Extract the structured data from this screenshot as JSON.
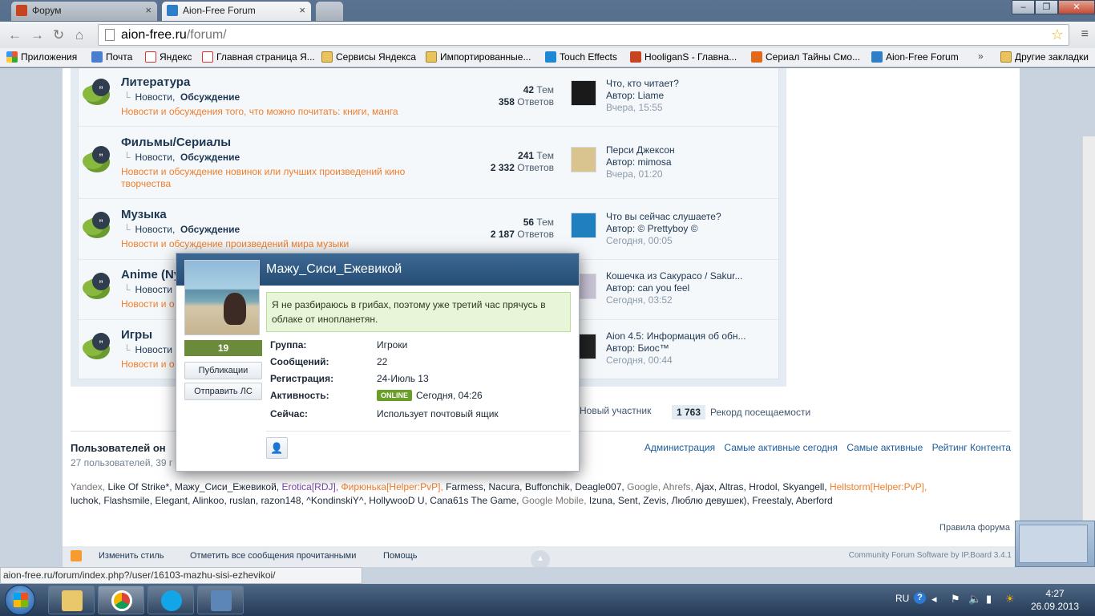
{
  "browser": {
    "tabs": [
      {
        "label": "Форум",
        "favicon_color": "#c8431f"
      },
      {
        "label": "Aion-Free Forum",
        "favicon_color": "#2f7fc8"
      }
    ],
    "url_host": "aion-free.ru",
    "url_path": "/forum/",
    "bookmarks": [
      {
        "label": "Приложения",
        "icon": "apps-icon"
      },
      {
        "label": "Почта",
        "icon": "mail-icon"
      },
      {
        "label": "Яндекс",
        "icon": "yandex-icon"
      },
      {
        "label": "Главная страница Я...",
        "icon": "yandex-icon"
      },
      {
        "label": "Сервисы Яндекса",
        "icon": "folder-icon"
      },
      {
        "label": "Импортированные...",
        "icon": "folder-icon"
      },
      {
        "label": "Touch Effects",
        "icon": "touch-icon"
      },
      {
        "label": "HooliganS - Главна...",
        "icon": "hooligans-icon"
      },
      {
        "label": "Сериал Тайны Смо...",
        "icon": "series-icon"
      },
      {
        "label": "Aion-Free Forum",
        "icon": "aion-icon"
      },
      {
        "label": "Другие закладки",
        "icon": "folder-icon"
      }
    ]
  },
  "forums": [
    {
      "name": "Литература",
      "subforums": [
        "Новости,",
        "Обсуждение"
      ],
      "description": "Новости и обсуждения того, что можно почитать: книги, манга",
      "topics": "42",
      "topics_label": "Тем",
      "replies": "358",
      "replies_label": "Ответов",
      "last_title": "Что, кто читает?",
      "last_author_prefix": "Автор: ",
      "last_author": "Liame",
      "last_time": "Вчера, 15:55",
      "avatar_color": "#1a1a1a"
    },
    {
      "name": "Фильмы/Сериалы",
      "subforums": [
        "Новости,",
        "Обсуждение"
      ],
      "description": "Новости и обсуждение новинок или лучших произведений кино творчества",
      "topics": "241",
      "topics_label": "Тем",
      "replies": "2 332",
      "replies_label": "Ответов",
      "last_title": "Перси Джексон",
      "last_author_prefix": "Автор: ",
      "last_author": "mimosa",
      "last_time": "Вчера, 01:20",
      "avatar_color": "#d9c48f"
    },
    {
      "name": "Музыка",
      "subforums": [
        "Новости,",
        "Обсуждение"
      ],
      "description": "Новости и обсуждение произведений мира музыки",
      "topics": "56",
      "topics_label": "Тем",
      "replies": "2 187",
      "replies_label": "Ответов",
      "last_title": "Что вы сейчас слушаете?",
      "last_author_prefix": "Автор: ",
      "last_author": "© Prettyboy ©",
      "last_time": "Сегодня, 00:05",
      "avatar_color": "#1f7fbf"
    },
    {
      "name": "Anime (Ny",
      "subforums": [
        "Новости"
      ],
      "description": "Новости и о",
      "topics": "",
      "topics_label": "",
      "replies": "",
      "replies_label": "",
      "last_title": "Кошечка из Сакурасо / Sakur...",
      "last_author_prefix": "Автор: ",
      "last_author": "can you feel",
      "last_time": "Сегодня, 03:52",
      "avatar_color": "#c9c3d6"
    },
    {
      "name": "Игры",
      "subforums": [
        "Новости"
      ],
      "description": "Новости и о",
      "topics": "",
      "topics_label": "",
      "replies": "",
      "replies_label": "",
      "last_title": "Aion 4.5: Информация об обн...",
      "last_author_prefix": "Автор: ",
      "last_author": "Биос™",
      "last_time": "Сегодня, 00:44",
      "avatar_color": "#222222"
    }
  ],
  "board_stats": {
    "new_member_label": "Новый участник",
    "record_value": "1 763",
    "record_label": "Рекорд посещаемости"
  },
  "online": {
    "title": "Пользователей он",
    "count": "27 пользователей, 39 г",
    "links": [
      "Администрация",
      "Самые активные сегодня",
      "Самые активные",
      "Рейтинг Контента"
    ],
    "users_line1": [
      {
        "name": "Yandex,",
        "style": "grey"
      },
      {
        "name": "Like Of Strike*,",
        "style": "normal"
      },
      {
        "name": "Мажу_Сиси_Ежевикой,",
        "style": "normal"
      },
      {
        "name": "Erotica[RDJ],",
        "style": "purple"
      },
      {
        "name": "Фирюнька[Helper:PvP],",
        "style": "orange"
      },
      {
        "name": "Farmess,",
        "style": "normal"
      },
      {
        "name": "Nacura,",
        "style": "normal"
      },
      {
        "name": "Buffonchik,",
        "style": "normal"
      },
      {
        "name": "Deagle007,",
        "style": "normal"
      },
      {
        "name": "Google,",
        "style": "grey"
      },
      {
        "name": "Ahrefs,",
        "style": "grey"
      },
      {
        "name": "Ajax,",
        "style": "normal"
      },
      {
        "name": "Altras,",
        "style": "normal"
      },
      {
        "name": "Hrodol,",
        "style": "normal"
      },
      {
        "name": "Skyangell,",
        "style": "normal"
      },
      {
        "name": "Hellstorm[Helper:PvP],",
        "style": "orange"
      }
    ],
    "users_line2": [
      {
        "name": "luchok,",
        "style": "normal"
      },
      {
        "name": "Flashsmile,",
        "style": "normal"
      },
      {
        "name": "Elegant,",
        "style": "normal"
      },
      {
        "name": "Alinkoo,",
        "style": "normal"
      },
      {
        "name": "ruslan,",
        "style": "normal"
      },
      {
        "name": "razon148,",
        "style": "normal"
      },
      {
        "name": "^KondinskiY^,",
        "style": "normal"
      },
      {
        "name": "HollywooD U,",
        "style": "normal"
      },
      {
        "name": "Cana61s The Game,",
        "style": "normal"
      },
      {
        "name": "Google Mobile,",
        "style": "grey"
      },
      {
        "name": "Izuna,",
        "style": "normal"
      },
      {
        "name": "Sent,",
        "style": "normal"
      },
      {
        "name": "Zevis,",
        "style": "normal"
      },
      {
        "name": "Люблю девушек),",
        "style": "normal"
      },
      {
        "name": "Freestaly,",
        "style": "normal"
      },
      {
        "name": "Aberford",
        "style": "normal"
      }
    ],
    "rules_link": "Правила форума"
  },
  "footer": {
    "change_style": "Изменить стиль",
    "mark_read": "Отметить все сообщения прочитанными",
    "help": "Помощь",
    "copyright": "Community Forum Software by IP.Board 3.4.1"
  },
  "hovercard": {
    "name": "Мажу_Сиси_Ежевикой",
    "reputation": "19",
    "btn_posts": "Публикации",
    "btn_pm": "Отправить ЛС",
    "status": "Я не разбираюсь в грибах, поэтому уже третий час прячусь в облаке от инопланетян.",
    "fields": [
      {
        "label": "Группа:",
        "value": "Игроки"
      },
      {
        "label": "Сообщений:",
        "value": "22"
      },
      {
        "label": "Регистрация:",
        "value": "24-Июль 13"
      },
      {
        "label": "Активность:",
        "value": "Сегодня, 04:26"
      },
      {
        "label": "Сейчас:",
        "value": "Использует почтовый ящик"
      }
    ],
    "online_badge": "ONLINE"
  },
  "status_url": "aion-free.ru/forum/index.php?/user/16103-mazhu-sisi-ezhevikoi/",
  "taskbar": {
    "apps": [
      "explorer-icon",
      "chrome-icon",
      "skype-icon",
      "network-icon"
    ],
    "lang": "RU",
    "time": "4:27",
    "date": "26.09.2013"
  }
}
